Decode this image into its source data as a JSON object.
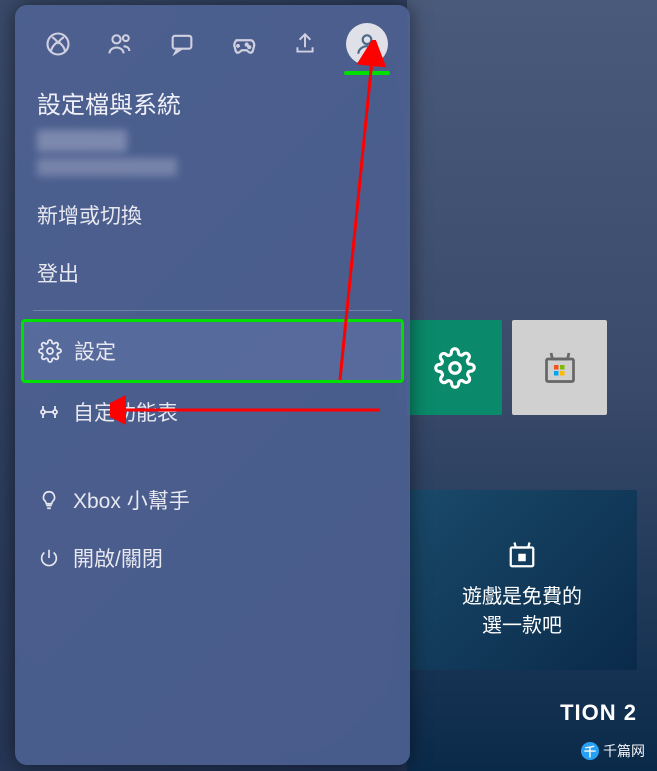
{
  "panel": {
    "title": "設定檔與系統",
    "menu": {
      "add_switch": "新增或切換",
      "sign_out": "登出",
      "settings": "設定",
      "customize": "自定功能表",
      "xbox_assist": "Xbox 小幫手",
      "power": "開啟/關閉"
    }
  },
  "background": {
    "banner_line1": "遊戲是免費的",
    "banner_line2": "選一款吧",
    "bottom_text": "TION 2"
  },
  "watermark": {
    "text": "千篇网"
  }
}
